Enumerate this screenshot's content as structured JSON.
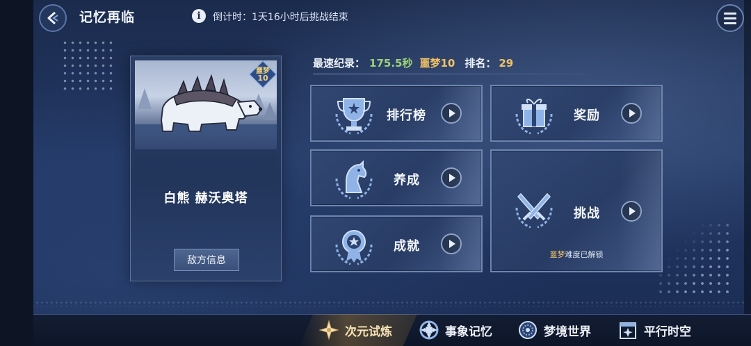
{
  "header": {
    "title": "记忆再临",
    "countdown": "倒计时：1天16小时后挑战结束"
  },
  "boss": {
    "name": "白熊 赫沃奥塔",
    "difficulty_label": "噩梦",
    "difficulty_level": "10",
    "info_button": "敌方信息"
  },
  "record": {
    "label": "最速纪录：",
    "time": "175.5秒",
    "difficulty": "噩梦10",
    "rank_label": "排名：",
    "rank": "29"
  },
  "menu": {
    "leaderboard": "排行榜",
    "rewards": "奖励",
    "develop": "养成",
    "achievements": "成就",
    "challenge": "挑战",
    "unlock_note_gold": "噩梦",
    "unlock_note_rest": "难度已解锁"
  },
  "bottom_nav": [
    {
      "label": "次元试炼",
      "active": true
    },
    {
      "label": "事象记忆",
      "active": false
    },
    {
      "label": "梦境世界",
      "active": false
    },
    {
      "label": "平行时空",
      "active": false
    }
  ],
  "colors": {
    "accent_gold": "#f1c265",
    "record_green": "#9ed27a",
    "panel_border": "#6e86b0"
  }
}
